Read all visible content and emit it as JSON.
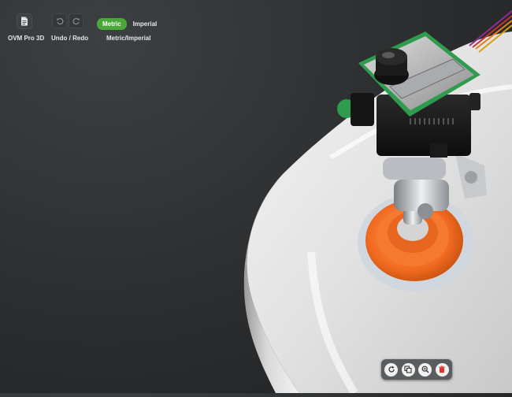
{
  "toolbar": {
    "product_label": "OVM Pro 3D",
    "undo_redo_label": "Undo / Redo",
    "units_label": "Metric/Imperial",
    "units": {
      "metric": "Metric",
      "imperial": "Imperial",
      "selected": "Metric"
    }
  },
  "icons": {
    "document": "document-icon",
    "undo": "undo-icon",
    "redo": "redo-icon",
    "reset_view": "rotate-reset-icon",
    "copy": "copy-icon",
    "zoom": "zoom-in-icon",
    "delete": "trash-icon"
  },
  "colors": {
    "accent": "#4aa83a",
    "delete": "#e0312c",
    "cup": "#f0691e",
    "module_green": "#2f9b4f"
  }
}
